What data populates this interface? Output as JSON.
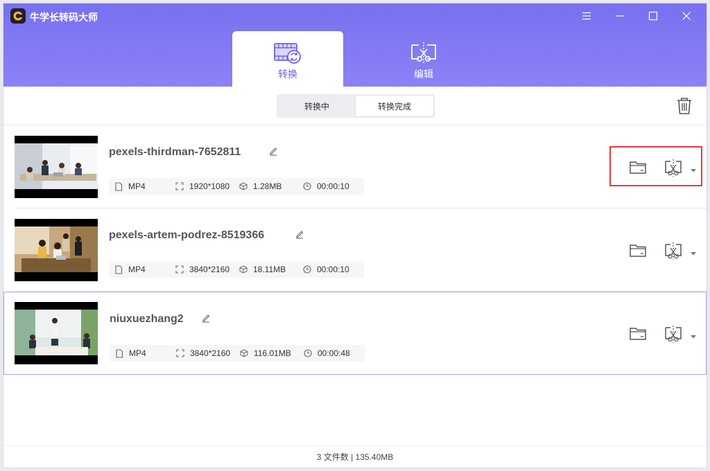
{
  "app": {
    "title": "牛学长转码大师"
  },
  "tabs": [
    {
      "label": "转换",
      "active": true
    },
    {
      "label": "编辑",
      "active": false
    }
  ],
  "segments": {
    "converting": "转换中",
    "done": "转换完成",
    "active": "done"
  },
  "files": [
    {
      "name": "pexels-thirdman-7652811",
      "format": "MP4",
      "resolution": "1920*1080",
      "size": "1.28MB",
      "duration": "00:00:10"
    },
    {
      "name": "pexels-artem-podrez-8519366",
      "format": "MP4",
      "resolution": "3840*2160",
      "size": "18.11MB",
      "duration": "00:00:10"
    },
    {
      "name": "niuxuezhang2",
      "format": "MP4",
      "resolution": "3840*2160",
      "size": "116.01MB",
      "duration": "00:00:48"
    }
  ],
  "status": {
    "text": "3 文件数 | 135.40MB"
  },
  "colors": {
    "accent": "#7970f0",
    "highlight": "#e53b3b"
  }
}
